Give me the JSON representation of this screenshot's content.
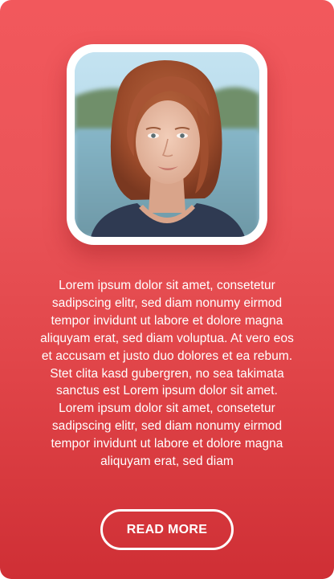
{
  "card": {
    "photo_alt": "Portrait of a young woman with auburn bob hair",
    "body_text": "Lorem ipsum dolor sit amet, consetetur sadipscing elitr, sed diam nonumy eirmod tempor invidunt ut labore et dolore magna aliquyam erat, sed diam voluptua. At vero eos et accusam et justo duo dolores et ea rebum. Stet clita kasd gubergren, no sea takimata sanctus est Lorem ipsum dolor sit amet. Lorem ipsum dolor sit amet, consetetur sadipscing elitr, sed diam nonumy eirmod tempor invidunt ut labore et dolore magna aliquyam erat, sed diam",
    "button_label": "READ MORE"
  },
  "colors": {
    "gradient_top": "#f2585c",
    "gradient_bottom": "#cf2f35",
    "button_border": "#ffffff",
    "text": "#ffffff"
  }
}
